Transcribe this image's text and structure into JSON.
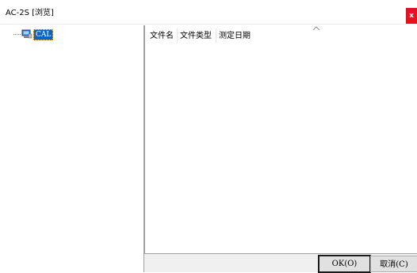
{
  "window": {
    "title": "AC-2S [浏览]",
    "close_label": "x"
  },
  "tree": {
    "items": [
      {
        "label": "CAL",
        "icon": "computer-icon",
        "selected": true
      }
    ]
  },
  "list": {
    "columns": [
      "文件名",
      "文件类型",
      "测定日期"
    ],
    "rows": []
  },
  "buttons": {
    "ok_label": "OK(O)",
    "cancel_label": "取消(C)"
  },
  "colors": {
    "selection": "#0a64c8",
    "close": "#e81123"
  }
}
